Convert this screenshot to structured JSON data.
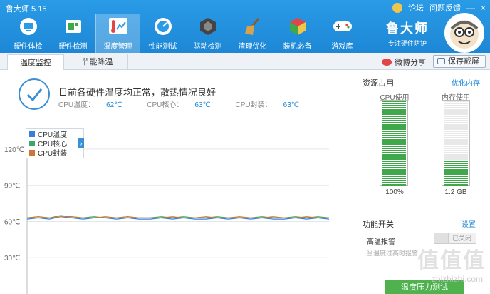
{
  "app": {
    "title": "鲁大师 5.15"
  },
  "topbar": {
    "links": [
      "论坛",
      "问题反馈"
    ],
    "window_buttons": [
      "—",
      "×"
    ],
    "nav": [
      {
        "label": "硬件体检",
        "icon": "monitor-icon"
      },
      {
        "label": "硬件检测",
        "icon": "board-icon"
      },
      {
        "label": "温度管理",
        "icon": "thermometer-icon",
        "active": true
      },
      {
        "label": "性能测试",
        "icon": "speedometer-icon"
      },
      {
        "label": "驱动检测",
        "icon": "driver-icon"
      },
      {
        "label": "清理优化",
        "icon": "broom-icon"
      },
      {
        "label": "装机必备",
        "icon": "cube-icon"
      },
      {
        "label": "游戏库",
        "icon": "gamepad-icon"
      }
    ],
    "brand_name": "鲁大师",
    "brand_slogan": "专注硬件防护"
  },
  "tabs": {
    "items": [
      "温度监控",
      "节能降温"
    ],
    "share": "微博分享",
    "save": "保存截屏"
  },
  "status": {
    "title": "目前各硬件温度均正常，散热情况良好",
    "readings": [
      {
        "label": "CPU温度：",
        "value": "62℃"
      },
      {
        "label": "CPU核心：",
        "value": "63℃"
      },
      {
        "label": "CPU封装：",
        "value": "63℃"
      }
    ]
  },
  "chart_data": {
    "type": "line",
    "ylabel": "",
    "y_ticks": [
      "120℃",
      "90℃",
      "60℃",
      "30℃"
    ],
    "ylim": [
      0,
      130
    ],
    "series": [
      {
        "name": "CPU温度",
        "color": "#3a7fd6",
        "values": [
          62,
          63,
          62,
          64,
          63,
          62,
          63,
          63,
          62,
          63,
          62,
          62,
          63,
          62,
          63,
          62,
          62,
          63,
          62,
          63,
          62,
          63,
          62,
          62,
          63,
          62,
          63,
          62
        ]
      },
      {
        "name": "CPU核心",
        "color": "#3aa86a",
        "values": [
          63,
          64,
          63,
          65,
          64,
          63,
          64,
          63,
          63,
          64,
          63,
          63,
          64,
          63,
          64,
          63,
          63,
          64,
          63,
          63,
          63,
          64,
          63,
          63,
          64,
          63,
          64,
          63
        ]
      },
      {
        "name": "CPU封装",
        "color": "#c9773a",
        "values": [
          63,
          64,
          63,
          64,
          64,
          63,
          63,
          64,
          63,
          64,
          63,
          63,
          63,
          64,
          63,
          63,
          64,
          63,
          63,
          64,
          63,
          63,
          64,
          63,
          63,
          64,
          63,
          63
        ]
      }
    ],
    "legend": "top-left",
    "grid": true
  },
  "resources": {
    "title": "资源占用",
    "optimize_link": "优化内存",
    "cpu": {
      "label": "CPU使用",
      "value": "100%",
      "level": 1.0,
      "color": "#3fa84b"
    },
    "mem": {
      "label": "内存使用",
      "value": "1.2 GB",
      "level": 0.3,
      "color": "#3fa84b"
    }
  },
  "functions": {
    "title": "功能开关",
    "settings_link": "设置",
    "high_temp_alarm": "高温报警",
    "toggle_state": "已关闭",
    "hint": "当温度过高时报警",
    "stress_button": "温度压力测试"
  },
  "watermark": {
    "text": "值值值",
    "url": "zhizhizhi.com"
  }
}
